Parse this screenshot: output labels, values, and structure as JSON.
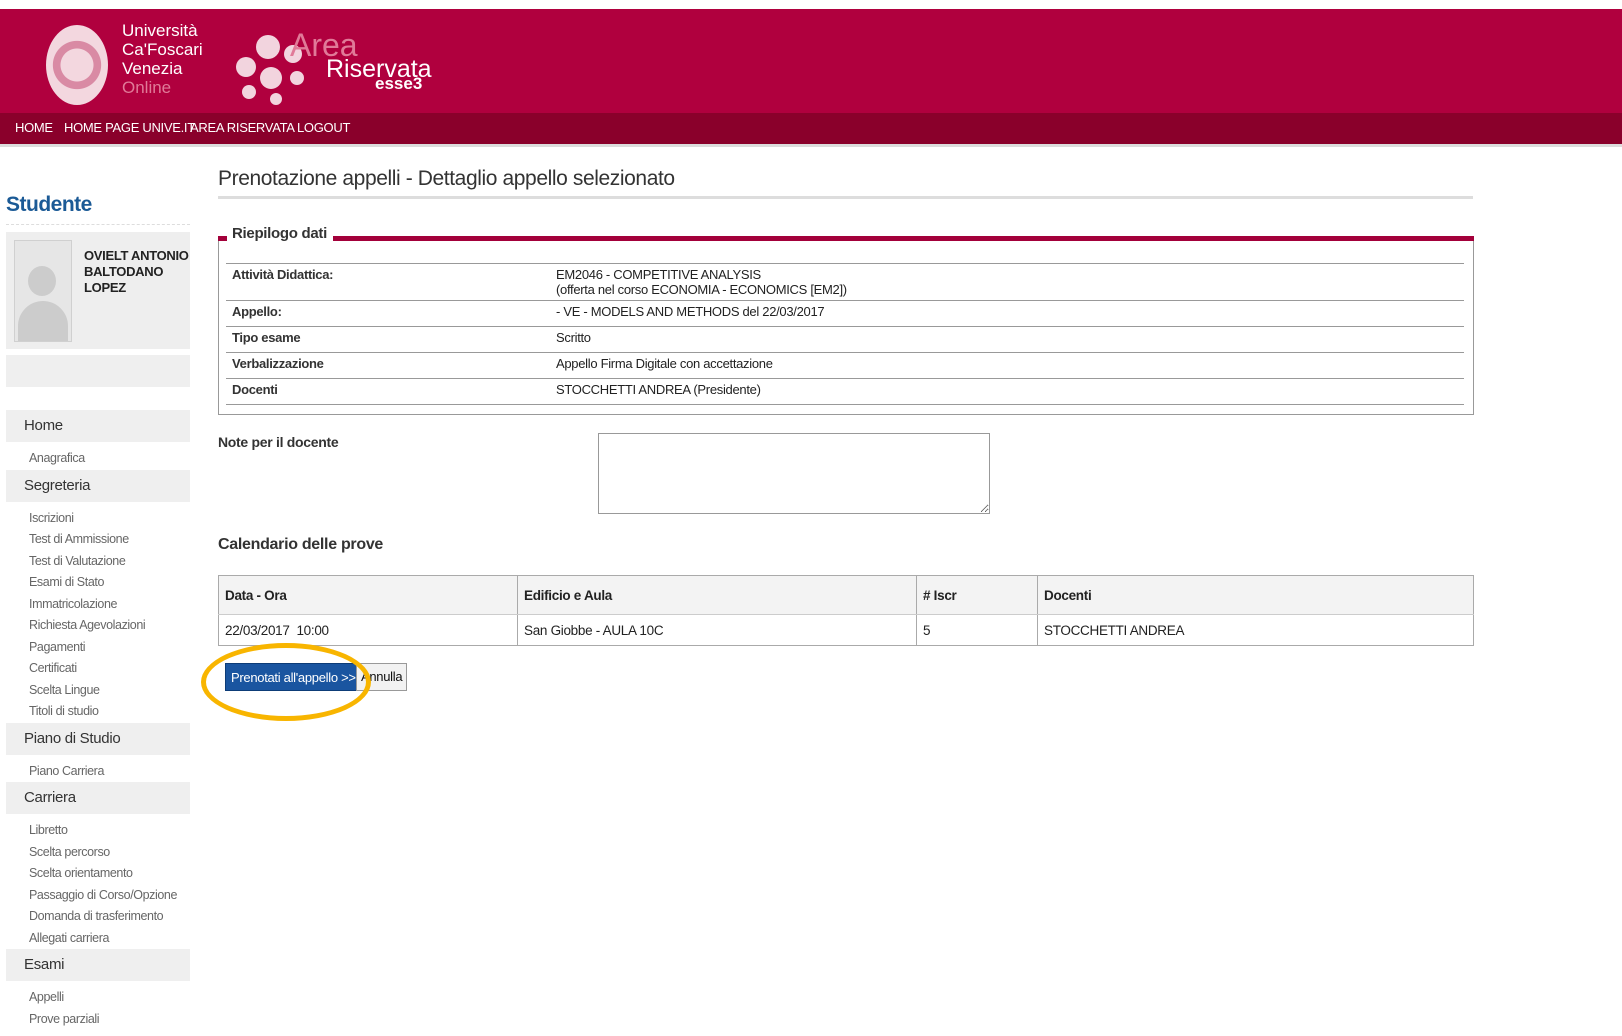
{
  "header": {
    "university_lines": [
      "Università",
      "Ca'Foscari",
      "Venezia"
    ],
    "online_label": "Online",
    "area_label": "Area",
    "riservata_label": "Riservata",
    "esse3_label": "esse3"
  },
  "nav": [
    "HOME",
    "HOME PAGE UNIVE.IT",
    "AREA RISERVATA",
    "LOGOUT"
  ],
  "sidebar": {
    "title": "Studente",
    "student_name_lines": [
      "OVIELT ANTONIO",
      "BALTODANO",
      "LOPEZ"
    ],
    "menu": [
      {
        "section": "Home",
        "items": [
          "Anagrafica"
        ]
      },
      {
        "section": "Segreteria",
        "items": [
          "Iscrizioni",
          "Test di Ammissione",
          "Test di Valutazione",
          "Esami di Stato",
          "Immatricolazione",
          "Richiesta Agevolazioni",
          "Pagamenti",
          "Certificati",
          "Scelta Lingue",
          "Titoli di studio"
        ]
      },
      {
        "section": "Piano di Studio",
        "items": [
          "Piano Carriera"
        ]
      },
      {
        "section": "Carriera",
        "items": [
          "Libretto",
          "Scelta percorso",
          "Scelta orientamento",
          "Passaggio di Corso/Opzione",
          "Domanda di trasferimento",
          "Allegati carriera"
        ]
      },
      {
        "section": "Esami",
        "items": [
          "Appelli",
          "Prove parziali"
        ]
      }
    ]
  },
  "main": {
    "page_title": "Prenotazione appelli - Dettaglio appello selezionato",
    "summary": {
      "legend": "Riepilogo dati",
      "rows": [
        {
          "label": "Attività Didattica:",
          "value": "EM2046 - COMPETITIVE ANALYSIS",
          "value2": "(offerta nel corso ECONOMIA - ECONOMICS [EM2])"
        },
        {
          "label": "Appello:",
          "value": "- VE - MODELS AND METHODS del 22/03/2017"
        },
        {
          "label": "Tipo esame",
          "value": "Scritto"
        },
        {
          "label": "Verbalizzazione",
          "value": "Appello Firma Digitale con accettazione"
        },
        {
          "label": "Docenti",
          "value": "STOCCHETTI ANDREA (Presidente)"
        }
      ]
    },
    "notes_label": "Note per il docente",
    "notes_value": "",
    "calendar": {
      "title": "Calendario delle prove",
      "headers": [
        "Data - Ora",
        "Edificio e Aula",
        "# Iscr",
        "Docenti"
      ],
      "rows": [
        [
          "22/03/2017  10:00",
          "San Giobbe - AULA 10C",
          "5",
          "STOCCHETTI ANDREA"
        ]
      ]
    },
    "book_button": "Prenotati all'appello >>",
    "cancel_button": "Annulla"
  },
  "colors": {
    "brand": "#b0003e",
    "nav": "#8a002b",
    "button": "#1a55a0",
    "highlight": "#f8b500",
    "title": "#1b5a96"
  }
}
